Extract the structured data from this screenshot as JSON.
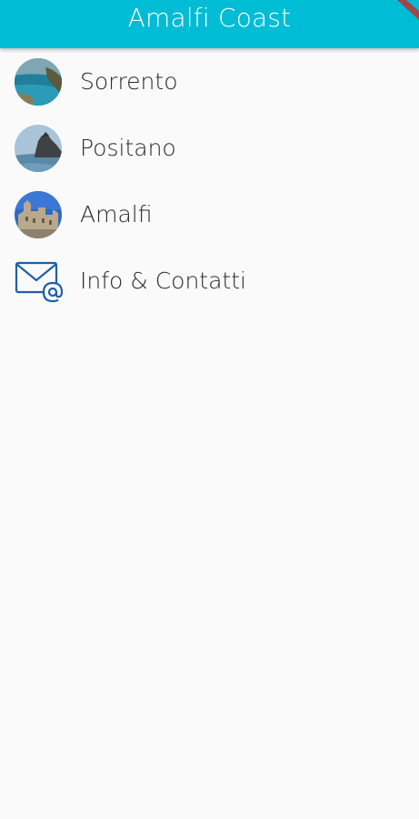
{
  "appbar": {
    "title": "Amalfi Coast",
    "color": "#00bcd4"
  },
  "list": {
    "items": [
      {
        "label": "Sorrento",
        "icon": "sorrento-photo"
      },
      {
        "label": "Positano",
        "icon": "positano-photo"
      },
      {
        "label": "Amalfi",
        "icon": "amalfi-photo"
      },
      {
        "label": "Info & Contatti",
        "icon": "mail-at-icon"
      }
    ]
  }
}
